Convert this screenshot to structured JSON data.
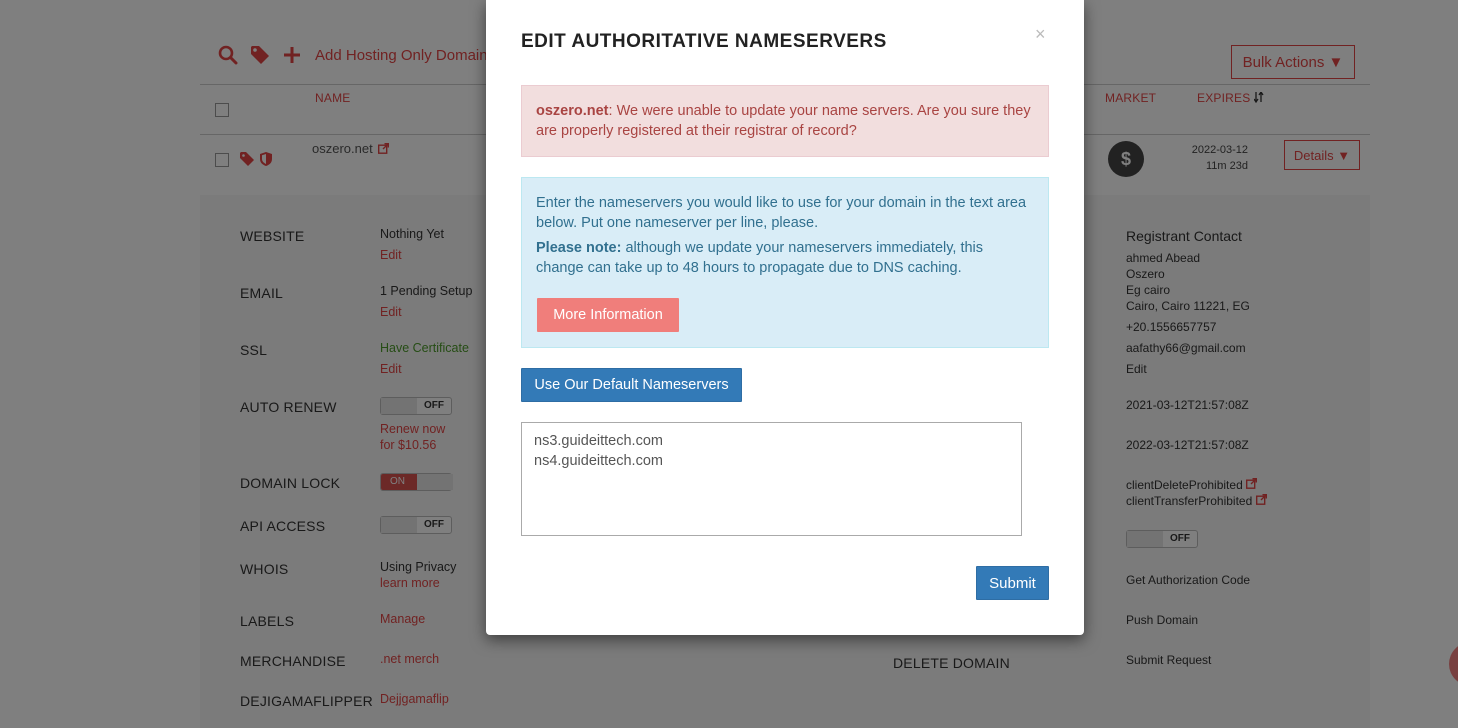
{
  "toolbar": {
    "add_label": "Add Hosting Only Domain",
    "bulk_label": "Bulk Actions ▼"
  },
  "table": {
    "headers": {
      "name": "NAME",
      "market": "MARKET",
      "expires": "EXPIRES"
    },
    "row": {
      "domain": "oszero.net",
      "expires_date": "2022-03-12",
      "expires_rel": "11m 23d",
      "details_label": "Details ▼",
      "market_icon": "$"
    }
  },
  "details": {
    "website": {
      "label": "WEBSITE",
      "value": "Nothing Yet",
      "edit": "Edit"
    },
    "email": {
      "label": "EMAIL",
      "value": "1 Pending Setup",
      "edit": "Edit"
    },
    "ssl": {
      "label": "SSL",
      "value": "Have Certificate",
      "edit": "Edit"
    },
    "auto_renew": {
      "label": "AUTO RENEW",
      "toggle": "OFF",
      "renew_line1": "Renew now",
      "renew_line2": "for $10.56"
    },
    "domain_lock": {
      "label": "DOMAIN LOCK",
      "toggle": "ON"
    },
    "api_access": {
      "label": "API ACCESS",
      "toggle": "OFF"
    },
    "whois": {
      "label": "WHOIS",
      "value": "Using Privacy",
      "link": "learn more"
    },
    "labels": {
      "label": "LABELS",
      "link": "Manage"
    },
    "merchandise": {
      "label": "MERCHANDISE",
      "link": ".net merch"
    },
    "dejiga": {
      "label": "DEJIGAMAFLIPPER",
      "link": "Dejjgamaflip"
    },
    "delete_domain": "DELETE DOMAIN",
    "registrant": {
      "title": "Registrant Contact",
      "name": "ahmed Abead",
      "org": "Oszero",
      "addr1": "Eg cairo",
      "addr2": "Cairo, Cairo 11221, EG",
      "phone": "+20.1556657757",
      "email": "aafathy66@gmail.com",
      "edit": "Edit"
    },
    "created": "2021-03-12T21:57:08Z",
    "expires_full": "2022-03-12T21:57:08Z",
    "status1": "clientDeleteProhibited",
    "status2": "clientTransferProhibited",
    "right_toggle": "OFF",
    "auth_code": "Get Authorization Code",
    "push_domain": "Push Domain",
    "submit_request": "Submit Request"
  },
  "modal": {
    "title": "EDIT AUTHORITATIVE NAMESERVERS",
    "close": "×",
    "error_domain": "oszero.net",
    "error_text": ": We were unable to update your name servers. Are you sure they are properly registered at their registrar of record?",
    "info_text": "Enter the nameservers you would like to use for your domain in the text area below. Put one nameserver per line, please.",
    "note_bold": "Please note:",
    "note_text": " although we update your nameservers immediately, this change can take up to 48 hours to propagate due to DNS caching.",
    "more_info_label": "More Information",
    "default_ns_label": "Use Our Default Nameservers",
    "nameservers": [
      "ns3.guideittech.com",
      "ns4.guideittech.com"
    ],
    "submit_label": "Submit"
  },
  "colors": {
    "accent": "#e24545",
    "primary": "#337ab7",
    "danger_bg": "#f2dede",
    "info_bg": "#d9edf7",
    "more_info_bg": "#f07e7b"
  }
}
